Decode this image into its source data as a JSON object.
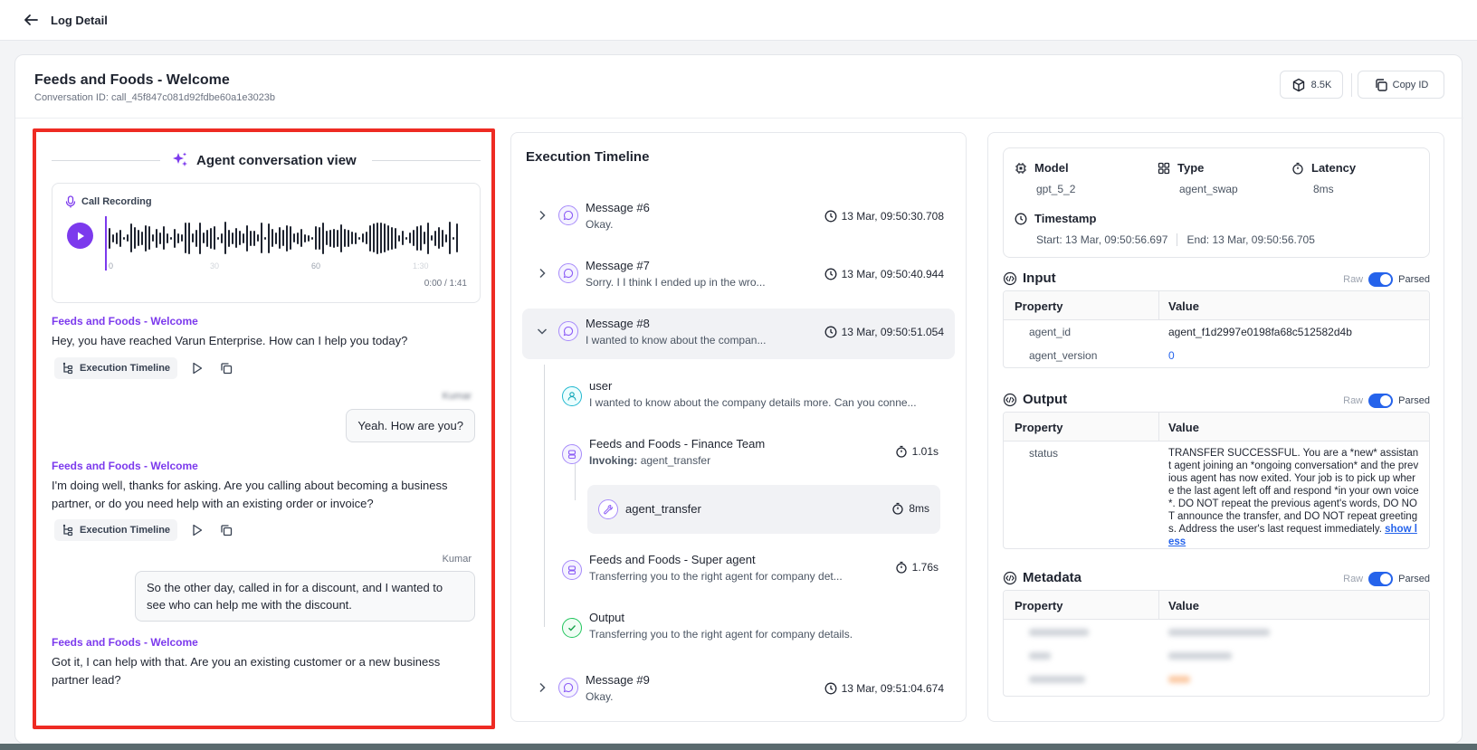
{
  "topbar": {
    "title": "Log Detail"
  },
  "header": {
    "title": "Feeds and Foods - Welcome",
    "conversation_id": "Conversation ID: call_45f847c081d92fdbe60a1e3023b",
    "tokens": "8.5K",
    "copy_label": "Copy ID"
  },
  "conversation": {
    "title": "Agent conversation view",
    "recording": {
      "label": "Call Recording",
      "time": "0:00 / 1:41",
      "ticks": [
        "0",
        "30",
        "60",
        "1:30"
      ]
    },
    "messages": [
      {
        "role": "agent",
        "speaker": "Feeds and Foods - Welcome",
        "text": "Hey, you have reached Varun Enterprise. How can I help you today?",
        "action": "Execution Timeline"
      },
      {
        "role": "user",
        "speaker": "Kumar",
        "text": "Yeah. How are you?"
      },
      {
        "role": "agent",
        "speaker": "Feeds and Foods - Welcome",
        "text": "I'm doing well, thanks for asking. Are you calling about becoming a business partner, or do you need help with an existing order or invoice?",
        "action": "Execution Timeline"
      },
      {
        "role": "user",
        "speaker": "Kumar",
        "text": "So the other day, called in for a discount, and I wanted to see who can help me with the discount."
      },
      {
        "role": "agent",
        "speaker": "Feeds and Foods - Welcome",
        "text": "Got it, I can help with that. Are you an existing customer or a new business partner lead?"
      }
    ]
  },
  "timeline": {
    "title": "Execution Timeline",
    "messages": [
      {
        "title": "Message #6",
        "preview": "Okay.",
        "time": "13 Mar, 09:50:30.708"
      },
      {
        "title": "Message #7",
        "preview": "Sorry. I I think I ended up in the wro...",
        "time": "13 Mar, 09:50:40.944"
      },
      {
        "title": "Message #8",
        "preview": "I wanted to know about the compan...",
        "time": "13 Mar, 09:50:51.054"
      },
      {
        "title": "Message #9",
        "preview": "Okay.",
        "time": "13 Mar, 09:51:04.674"
      }
    ],
    "steps": {
      "user": {
        "title": "user",
        "text": "I wanted to know about the company details more. Can you conne..."
      },
      "finance": {
        "title": "Feeds and Foods - Finance Team",
        "invoking_label": "Invoking:",
        "invoking": "agent_transfer",
        "duration": "1.01s"
      },
      "tool": {
        "name": "agent_transfer",
        "duration": "8ms"
      },
      "super": {
        "title": "Feeds and Foods - Super agent",
        "text": "Transferring you to the right agent for company det...",
        "duration": "1.76s"
      },
      "output": {
        "title": "Output",
        "text": "Transferring you to the right agent for company details."
      }
    }
  },
  "details": {
    "model": {
      "label": "Model",
      "value": "gpt_5_2"
    },
    "type": {
      "label": "Type",
      "value": "agent_swap"
    },
    "latency": {
      "label": "Latency",
      "value": "8ms"
    },
    "timestamp": {
      "label": "Timestamp",
      "start": "Start: 13 Mar, 09:50:56.697",
      "end": "End: 13 Mar, 09:50:56.705"
    },
    "toggle": {
      "raw": "Raw",
      "parsed": "Parsed"
    },
    "columns": {
      "property": "Property",
      "value": "Value"
    },
    "input": {
      "title": "Input",
      "rows": [
        {
          "property": "agent_id",
          "value": "agent_f1d2997e0198fa68c512582d4b"
        },
        {
          "property": "agent_version",
          "value": "0"
        }
      ]
    },
    "output": {
      "title": "Output",
      "property": "status",
      "value": "TRANSFER SUCCESSFUL. You are a *new* assistant agent joining an *ongoing conversation* and the previous agent has now exited. Your job is to pick up where the last agent left off and respond *in your own voice*. DO NOT repeat the previous agent's words, DO NOT announce the transfer, and DO NOT repeat greetings. Address the user's last request immediately.",
      "show_less": "show less"
    },
    "metadata": {
      "title": "Metadata"
    }
  }
}
